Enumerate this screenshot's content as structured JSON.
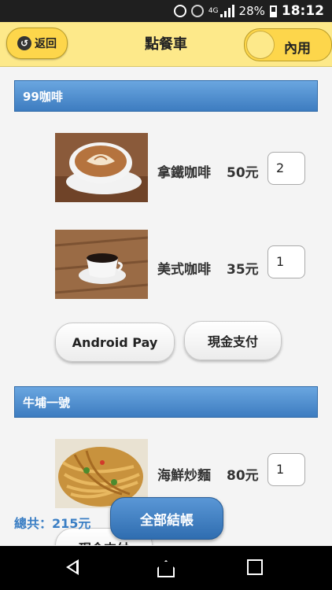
{
  "status": {
    "network": "4G",
    "battery": "28%",
    "time": "18:12"
  },
  "header": {
    "back_label": "返回",
    "title": "點餐車",
    "mode_label": "內用"
  },
  "sections": [
    {
      "title": "99咖啡",
      "items": [
        {
          "name": "拿鐵咖啡",
          "price": "50元",
          "qty": "2"
        },
        {
          "name": "美式咖啡",
          "price": "35元",
          "qty": "1"
        }
      ],
      "payments": [
        "Android Pay",
        "現金支付"
      ]
    },
    {
      "title": "牛埔一號",
      "items": [
        {
          "name": "海鮮炒麵",
          "price": "80元",
          "qty": "1"
        }
      ],
      "payments": [
        "現金支付"
      ]
    }
  ],
  "footer": {
    "total": "總共：215元",
    "checkout_label": "全部結帳"
  },
  "colors": {
    "header": "#fde98a",
    "toggle": "#fdd64b",
    "section": "#3d7cc0",
    "total_text": "#3a7ec4"
  }
}
